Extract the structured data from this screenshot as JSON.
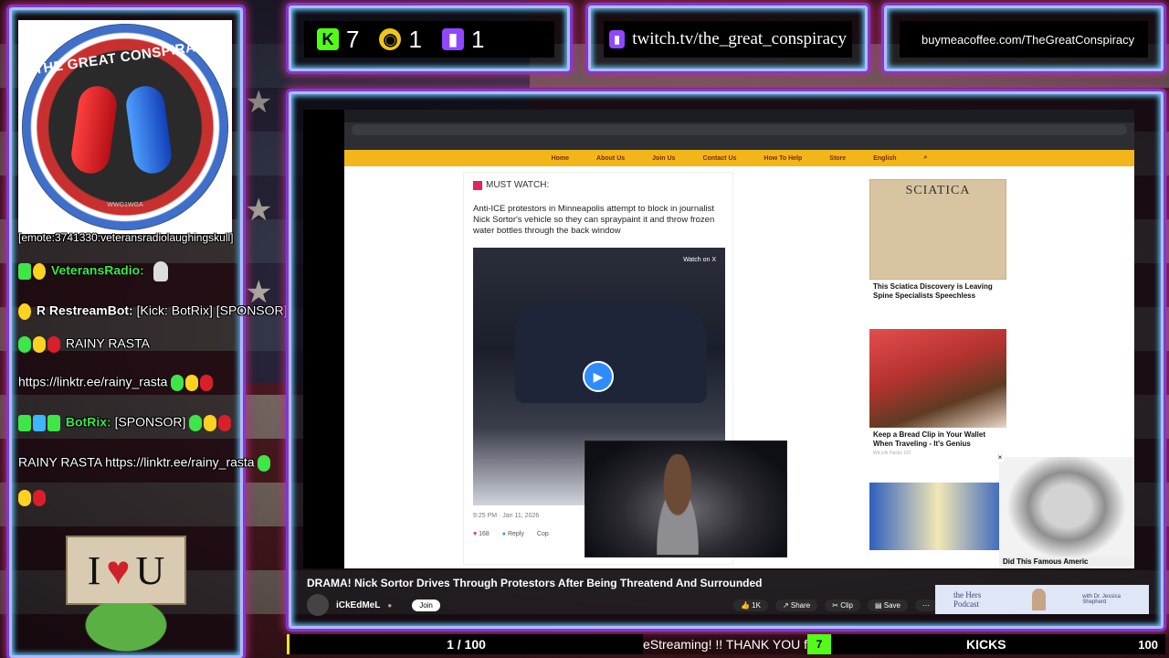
{
  "stats": {
    "kick": {
      "icon": "kick-icon",
      "count": "7"
    },
    "rumble": {
      "icon": "rumble-icon",
      "count": "1"
    },
    "twitch": {
      "icon": "twitch-icon",
      "count": "1"
    }
  },
  "links": {
    "twitch_url": "twitch.tv/the_great_conspiracy",
    "bmc_url": "buymeacoffee.com/TheGreatConspiracy"
  },
  "logo": {
    "title": "THE GREAT CONSPIRACY",
    "sub": "WWG1WGA"
  },
  "chat": {
    "line0": "[emote:3741330:veteransradiolaughingskull]",
    "line1_nick": "VeteransRadio:",
    "line2_nick": "RestreamBot:",
    "line2_letter": "R",
    "line2_msg": "[Kick: BotRix] [SPONSOR]",
    "line3_msg": "RAINY RASTA",
    "line4_msg": "https://linktr.ee/rainy_rasta",
    "line5_nick": "BotRix:",
    "line5_msg": "[SPONSOR]",
    "line6_msg": "RAINY RASTA https://linktr.ee/rainy_rasta"
  },
  "sign": {
    "left": "I",
    "right": "U"
  },
  "browser": {
    "nav": [
      "Home",
      "About Us",
      "Join Us",
      "Contact Us",
      "How To Help",
      "Store",
      "English"
    ],
    "post_head": "MUST WATCH:",
    "post_text": "Anti-ICE protestors in Minneapolis attempt to block in journalist Nick Sortor's vehicle so they can spraypaint it and throw frozen water bottles through the back window",
    "watch_label": "Watch on X",
    "post_meta": "9:25 PM · Jan 11, 2026",
    "likes": "168",
    "reply": "Reply",
    "copy": "Cop"
  },
  "ads": [
    {
      "title": "SCIATICA",
      "caption": "This Sciatica Discovery is Leaving Spine Specialists Speechless"
    },
    {
      "caption": "Keep a Bread Clip in Your Wallet When Traveling - It's Genius",
      "source": "Wit Life Hacks 162"
    }
  ],
  "drphil_caption": "Did This Famous Americ",
  "youtube": {
    "title": "DRAMA! Nick Sortor Drives Through Protestors After Being Threatend And Surrounded",
    "channel": "iCkEdMeL",
    "join": "Join",
    "like_count": "1K",
    "share": "Share",
    "clip": "Clip",
    "save": "Save",
    "promo_title": "the Hers Podcast",
    "promo_sub": "with Dr. Jessica Shepherd"
  },
  "bottom": {
    "progress": "1 / 100",
    "ticker": "eStreaming!    !!    THANK YOU fr",
    "kick_badge": "7",
    "kicks_label": "KICKS",
    "kicks_goal": "100"
  },
  "colors": {
    "kick": "#53fc18",
    "twitch": "#9146ff",
    "rumble": "#f0c419",
    "neon": "#c12a8a"
  }
}
